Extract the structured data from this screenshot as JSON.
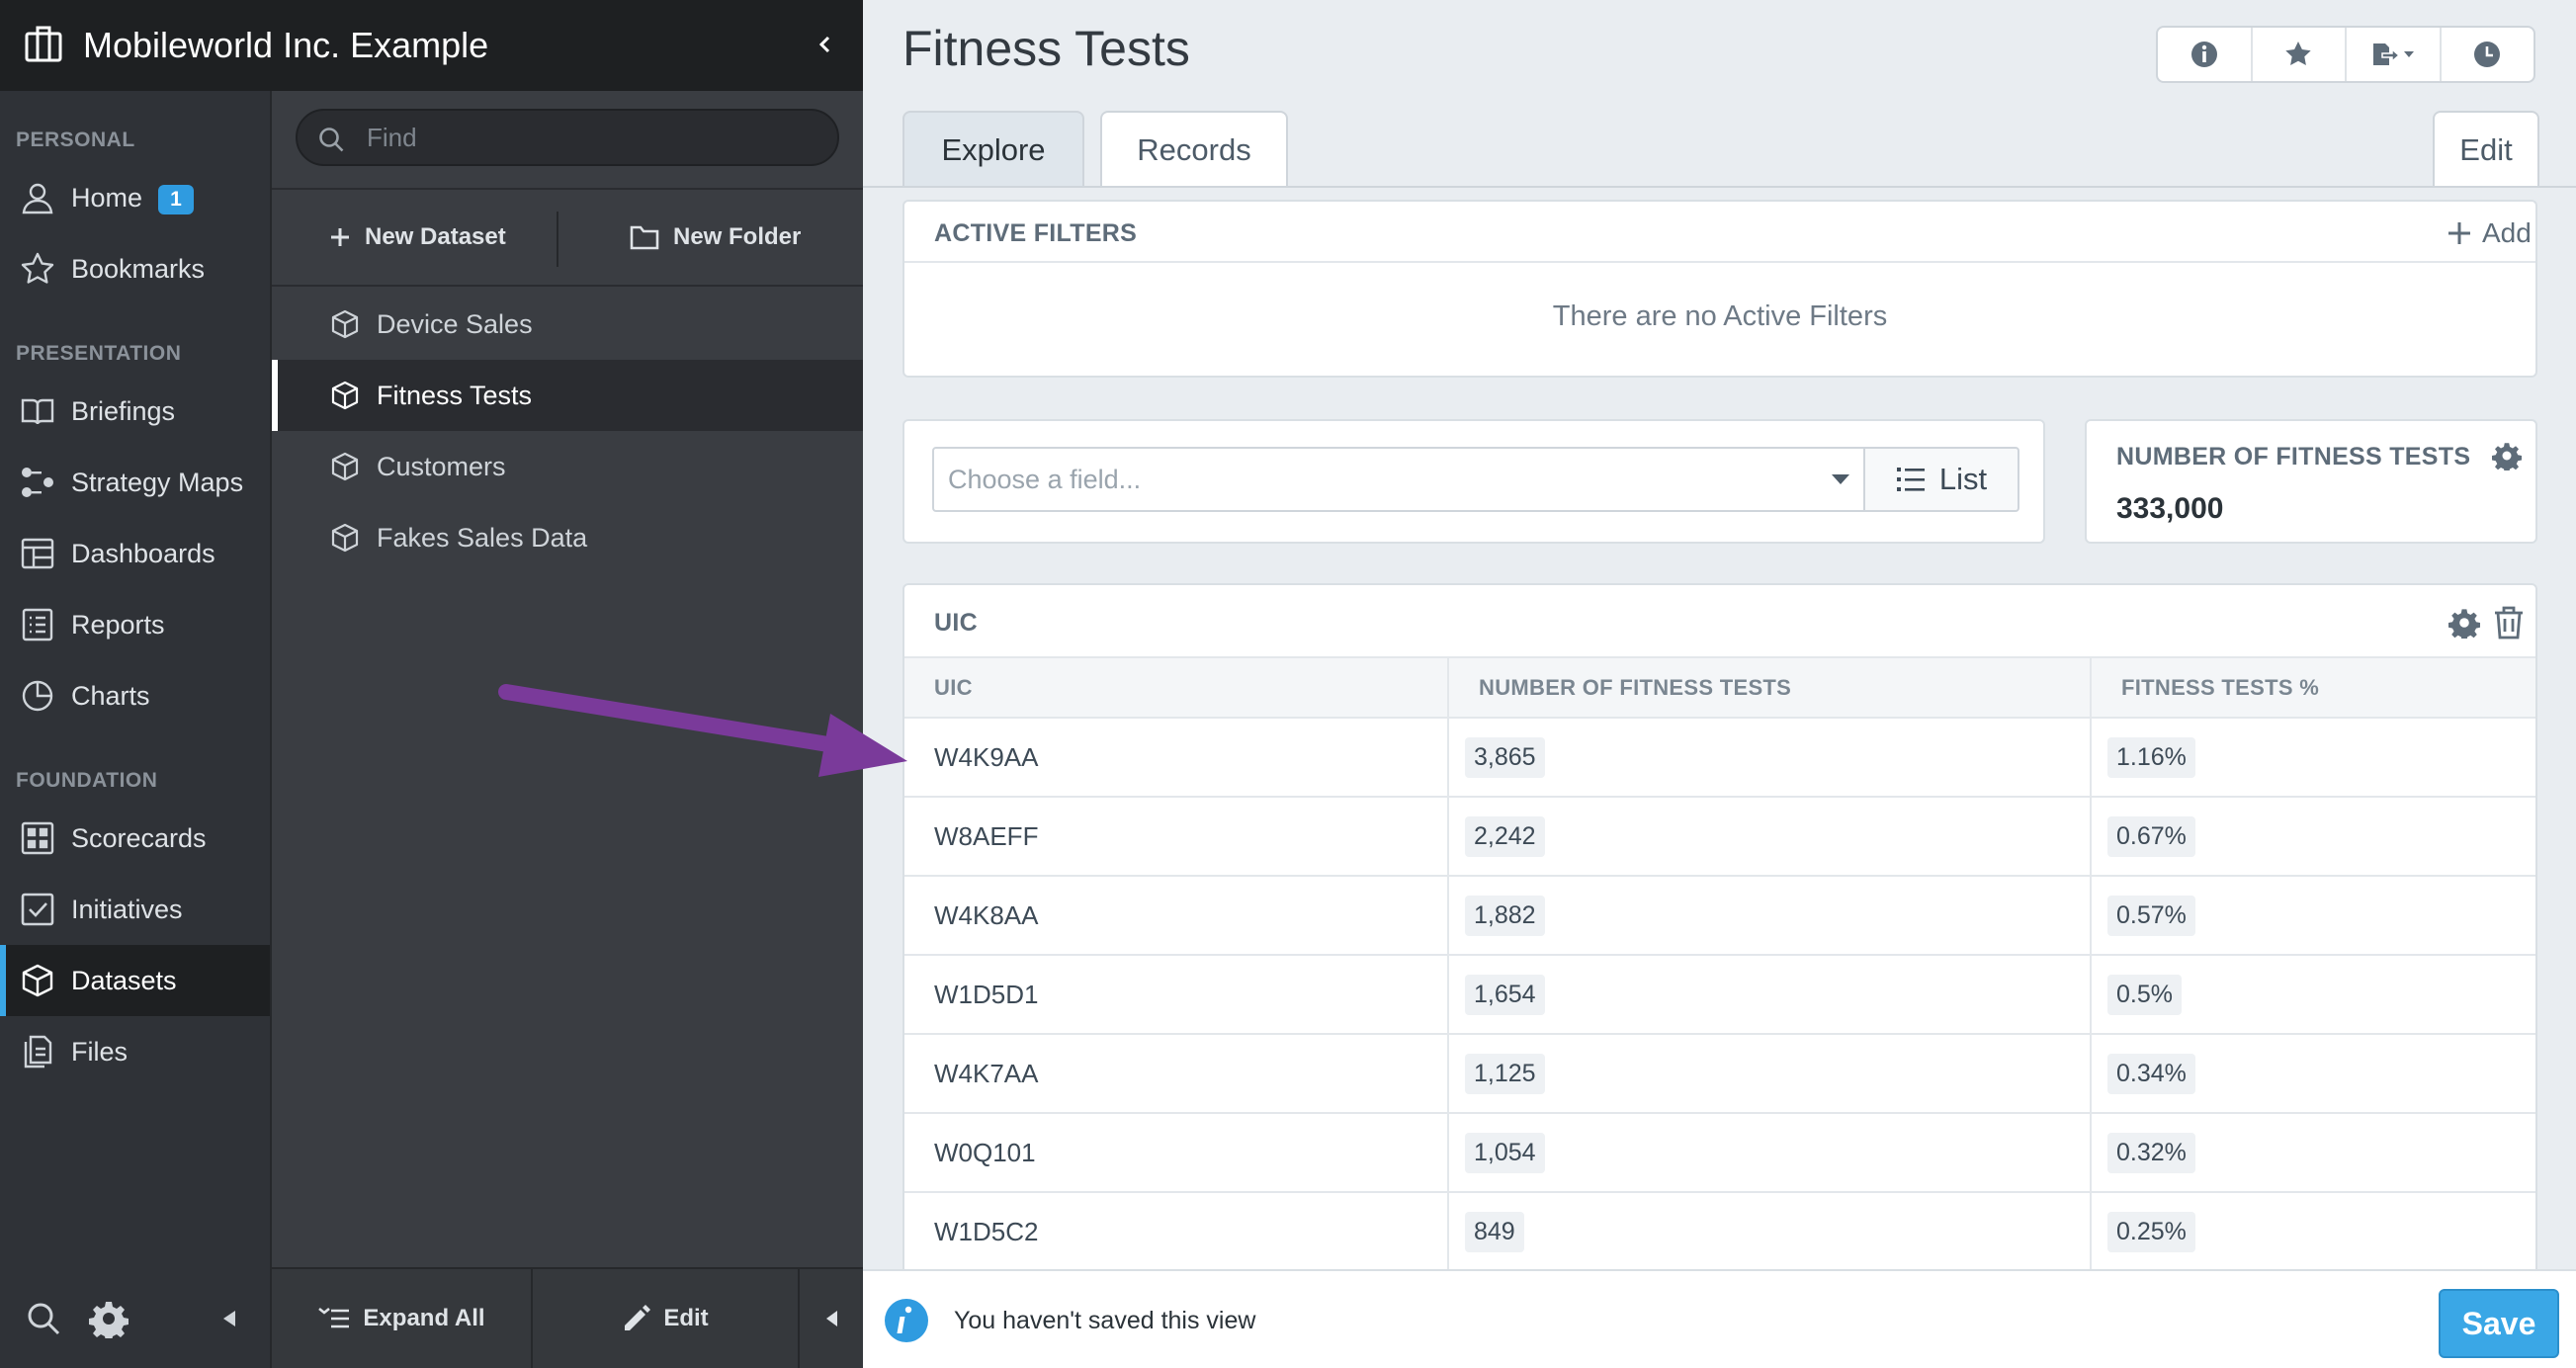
{
  "org": {
    "name": "Mobileworld Inc. Example"
  },
  "nav": {
    "sections": {
      "personal": "PERSONAL",
      "presentation": "PRESENTATION",
      "foundation": "FOUNDATION"
    },
    "items": [
      {
        "label": "Home",
        "icon": "user-icon",
        "badge": "1"
      },
      {
        "label": "Bookmarks",
        "icon": "star-icon"
      },
      {
        "label": "Briefings",
        "icon": "book-icon"
      },
      {
        "label": "Strategy Maps",
        "icon": "strategy-map-icon"
      },
      {
        "label": "Dashboards",
        "icon": "dashboard-icon"
      },
      {
        "label": "Reports",
        "icon": "report-icon"
      },
      {
        "label": "Charts",
        "icon": "pie-chart-icon"
      },
      {
        "label": "Scorecards",
        "icon": "scorecard-icon"
      },
      {
        "label": "Initiatives",
        "icon": "checkbox-icon"
      },
      {
        "label": "Datasets",
        "icon": "cube-icon",
        "active": true
      },
      {
        "label": "Files",
        "icon": "files-icon"
      }
    ]
  },
  "datasets": {
    "search_placeholder": "Find",
    "new_dataset": "New Dataset",
    "new_folder": "New Folder",
    "items": [
      {
        "label": "Device Sales"
      },
      {
        "label": "Fitness Tests",
        "active": true
      },
      {
        "label": "Customers"
      },
      {
        "label": "Fakes Sales Data"
      }
    ],
    "expand_all": "Expand All",
    "edit": "Edit"
  },
  "main": {
    "title": "Fitness Tests",
    "tabs": [
      {
        "label": "Explore",
        "active": true
      },
      {
        "label": "Records"
      }
    ],
    "edit_tab": "Edit",
    "filters": {
      "title": "ACTIVE FILTERS",
      "add": "Add",
      "empty": "There are no Active Filters"
    },
    "field_placeholder": "Choose a field...",
    "list_button": "List",
    "metric": {
      "title": "NUMBER OF FITNESS TESTS",
      "value": "333,000"
    },
    "table": {
      "title": "UIC",
      "columns": [
        "UIC",
        "NUMBER OF FITNESS TESTS",
        "FITNESS TESTS %"
      ],
      "rows": [
        [
          "W4K9AA",
          "3,865",
          "1.16%"
        ],
        [
          "W8AEFF",
          "2,242",
          "0.67%"
        ],
        [
          "W4K8AA",
          "1,882",
          "0.57%"
        ],
        [
          "W1D5D1",
          "1,654",
          "0.5%"
        ],
        [
          "W4K7AA",
          "1,125",
          "0.34%"
        ],
        [
          "W0Q101",
          "1,054",
          "0.32%"
        ],
        [
          "W1D5C2",
          "849",
          "0.25%"
        ]
      ]
    },
    "status": {
      "message": "You haven't saved this view",
      "save": "Save"
    }
  },
  "colors": {
    "accent": "#3aa7e6",
    "nav_bg": "#2f3237",
    "annotation_arrow": "#7a3a9a"
  }
}
